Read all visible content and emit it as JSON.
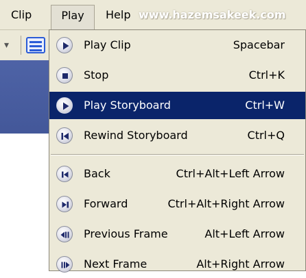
{
  "menubar": {
    "clip": "Clip",
    "play": "Play",
    "help": "Help"
  },
  "watermark": "www.hazemsakeek.com",
  "menu": {
    "items": [
      {
        "label": "Play Clip",
        "shortcut": "Spacebar",
        "icon": "play-icon"
      },
      {
        "label": "Stop",
        "shortcut": "Ctrl+K",
        "icon": "stop-icon"
      },
      {
        "label": "Play Storyboard",
        "shortcut": "Ctrl+W",
        "icon": "play-icon",
        "highlighted": true
      },
      {
        "label": "Rewind Storyboard",
        "shortcut": "Ctrl+Q",
        "icon": "rewind-icon"
      },
      {
        "label": "Back",
        "shortcut": "Ctrl+Alt+Left Arrow",
        "icon": "back-icon"
      },
      {
        "label": "Forward",
        "shortcut": "Ctrl+Alt+Right Arrow",
        "icon": "forward-icon"
      },
      {
        "label": "Previous Frame",
        "shortcut": "Alt+Left Arrow",
        "icon": "previous-frame-icon"
      },
      {
        "label": "Next Frame",
        "shortcut": "Alt+Right Arrow",
        "icon": "next-frame-icon"
      }
    ]
  },
  "colors": {
    "menu_bg": "#ece9d8",
    "highlight": "#0a246a",
    "icon_glyph": "#1f2a6b"
  }
}
